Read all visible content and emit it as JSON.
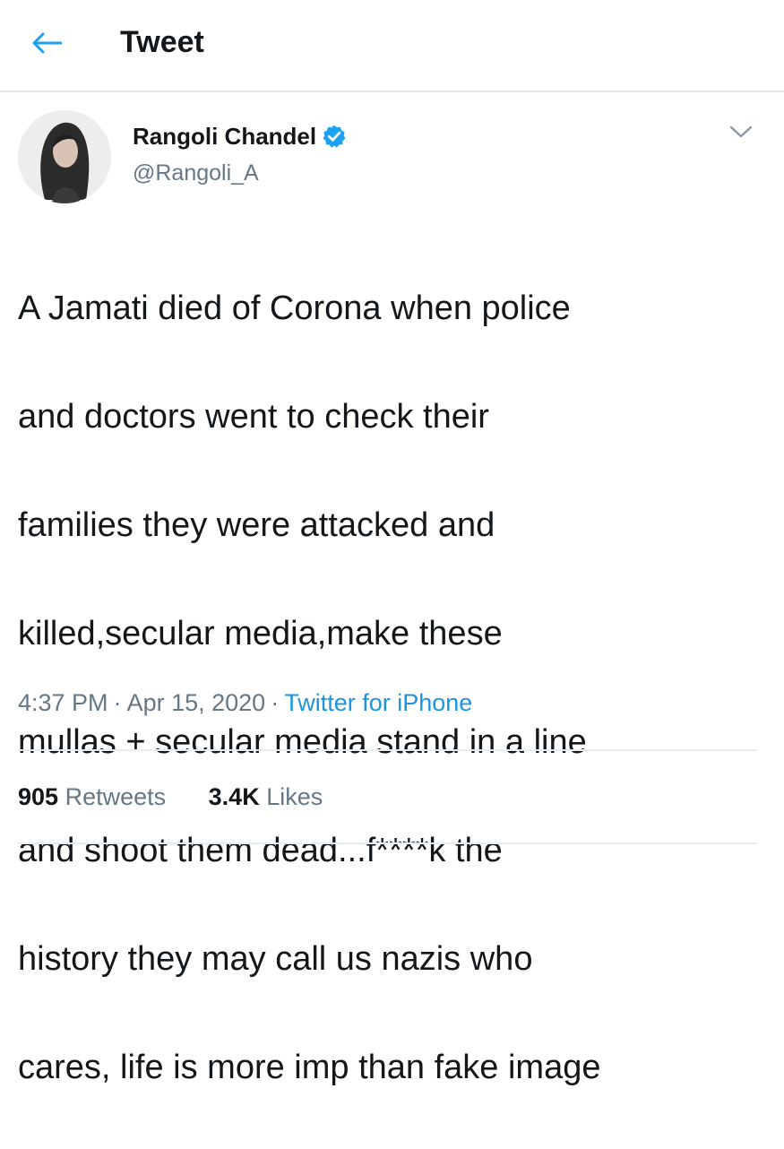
{
  "header": {
    "back_icon": "arrow-left-icon",
    "title": "Tweet"
  },
  "author": {
    "name": "Rangoli Chandel",
    "handle": "@Rangoli_A",
    "verified_icon": "verified-badge-icon",
    "menu_icon": "chevron-down-icon"
  },
  "tweet": {
    "lines": [
      "A Jamati died of Corona when police",
      "and doctors went to check their",
      "families they were attacked and",
      "killed,secular media,make these",
      "mullas + secular media stand in a line",
      "and shoot them dead...f****k the",
      "history they may call us nazis who",
      "cares, life is more imp than fake image"
    ],
    "time": "4:37 PM",
    "date": "Apr 15, 2020",
    "separator": "·",
    "source": "Twitter for iPhone"
  },
  "stats": {
    "retweets_count": "905",
    "retweets_label": "Retweets",
    "likes_count": "3.4K",
    "likes_label": "Likes"
  },
  "colors": {
    "accent": "#1b95e0",
    "text_primary": "#14171a",
    "text_secondary": "#657786",
    "divider": "#e6ecf0"
  }
}
